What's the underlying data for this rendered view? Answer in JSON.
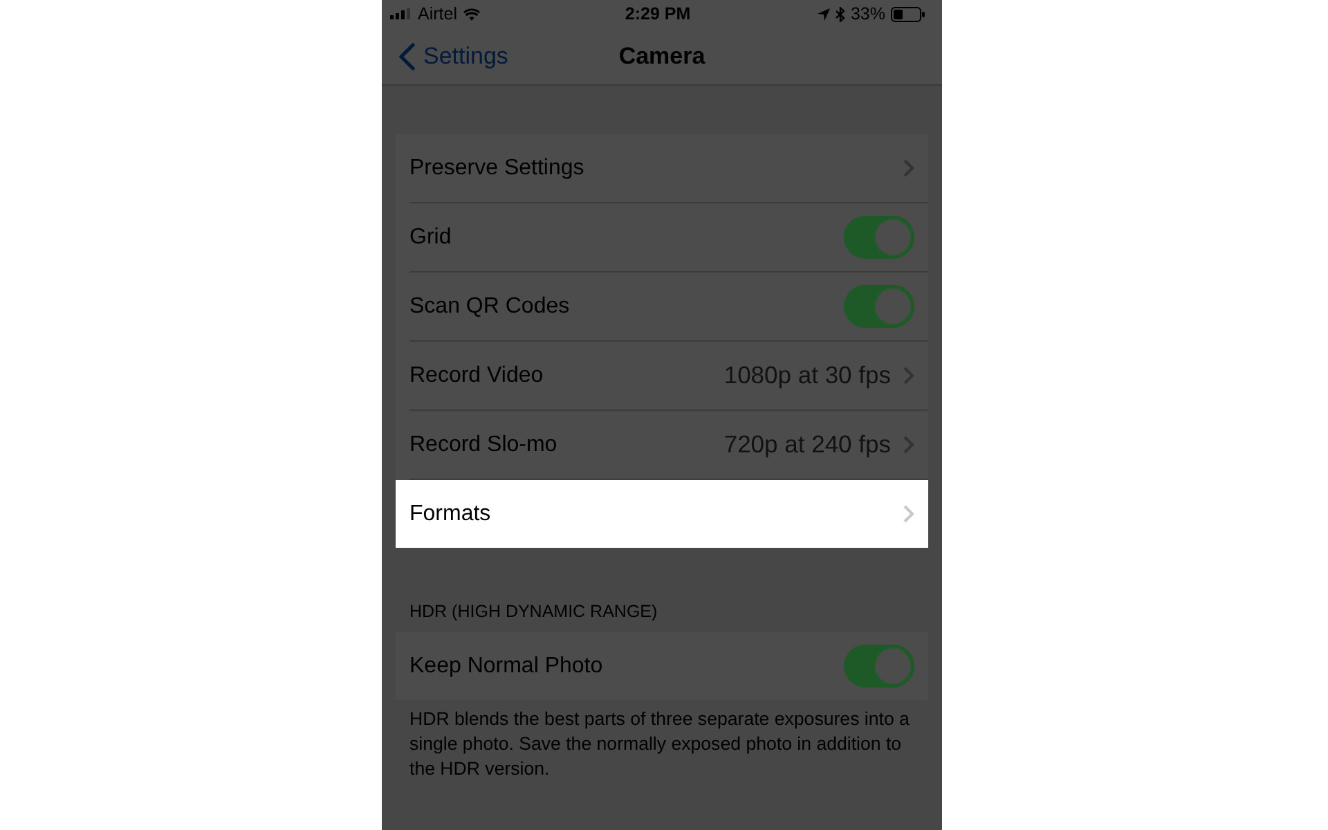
{
  "status_bar": {
    "carrier": "Airtel",
    "time": "2:29 PM",
    "battery": "33%"
  },
  "nav_bar": {
    "back": "Settings",
    "title": "Camera"
  },
  "groups": [
    {
      "rows": [
        {
          "kind": "link",
          "label": "Preserve Settings",
          "highlighted": false
        },
        {
          "kind": "toggle",
          "label": "Grid",
          "on": true,
          "highlighted": false
        },
        {
          "kind": "toggle",
          "label": "Scan QR Codes",
          "on": true,
          "highlighted": false
        },
        {
          "kind": "link",
          "label": "Record Video",
          "value": "1080p at 30 fps",
          "highlighted": false
        },
        {
          "kind": "link",
          "label": "Record Slo-mo",
          "value": "720p at 240 fps",
          "highlighted": false
        },
        {
          "kind": "link",
          "label": "Formats",
          "highlighted": true
        }
      ]
    },
    {
      "header": "HDR (HIGH DYNAMIC RANGE)",
      "rows": [
        {
          "kind": "toggle",
          "label": "Keep Normal Photo",
          "on": true,
          "highlighted": false
        }
      ],
      "footer": "HDR blends the best parts of three separate exposures into a single photo. Save the normally exposed photo in addition to the HDR version."
    }
  ]
}
